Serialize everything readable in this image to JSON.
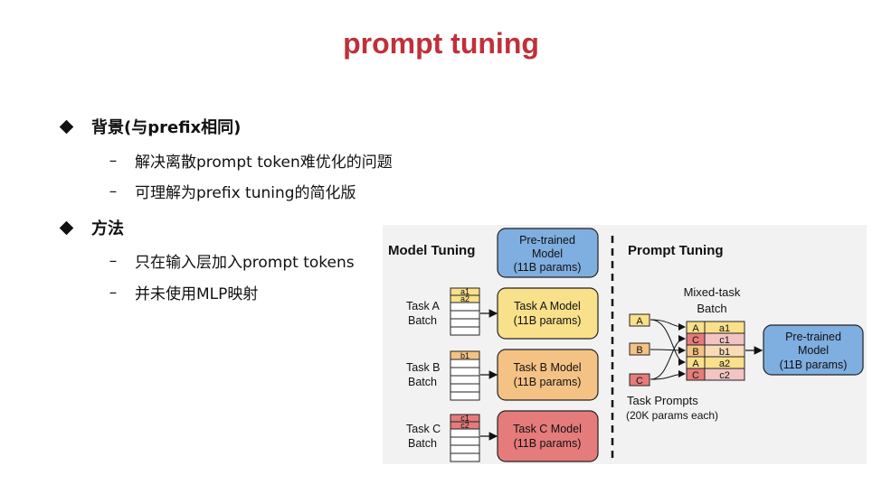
{
  "slide": {
    "title": "prompt tuning",
    "sections": [
      {
        "heading": "背景(与prefix相同)",
        "items": [
          "解决离散prompt token难优化的问题",
          "可理解为prefix tuning的简化版"
        ]
      },
      {
        "heading": "方法",
        "items": [
          "只在输入层加入prompt tokens",
          "并未使用MLP映射"
        ]
      }
    ],
    "dash": "–"
  },
  "figure": {
    "model_tuning_title": "Model Tuning",
    "prompt_tuning_title": "Prompt Tuning",
    "pretrained_top": [
      "Pre-trained",
      "Model",
      "(11B params)"
    ],
    "tasks": [
      {
        "label1": "Task A",
        "label2": "Batch",
        "tokens": [
          "a1",
          "a2"
        ],
        "model": [
          "Task A Model",
          "(11B params)"
        ],
        "color": "#f9e08a"
      },
      {
        "label1": "Task B",
        "label2": "Batch",
        "tokens": [
          "b1"
        ],
        "model": [
          "Task B Model",
          "(11B params)"
        ],
        "color": "#f5c285"
      },
      {
        "label1": "Task C",
        "label2": "Batch",
        "tokens": [
          "c1",
          "c2"
        ],
        "model": [
          "Task C Model",
          "(11B params)"
        ],
        "color": "#e57b7b"
      }
    ],
    "mixed_batch_title": [
      "Mixed-task",
      "Batch"
    ],
    "prompt_letters": [
      "A",
      "B",
      "C"
    ],
    "mixed_rows": [
      [
        "A",
        "a1"
      ],
      [
        "C",
        "c1"
      ],
      [
        "B",
        "b1"
      ],
      [
        "A",
        "a2"
      ],
      [
        "C",
        "c2"
      ]
    ],
    "pretrained_right": [
      "Pre-trained",
      "Model",
      "(11B params)"
    ],
    "task_prompts": [
      "Task Prompts",
      "(20K params each)"
    ],
    "colors": {
      "A": "#f9e08a",
      "B": "#f5c285",
      "C": "#e57b7b",
      "blue": "#7faee0",
      "title": "#c0303a"
    }
  }
}
